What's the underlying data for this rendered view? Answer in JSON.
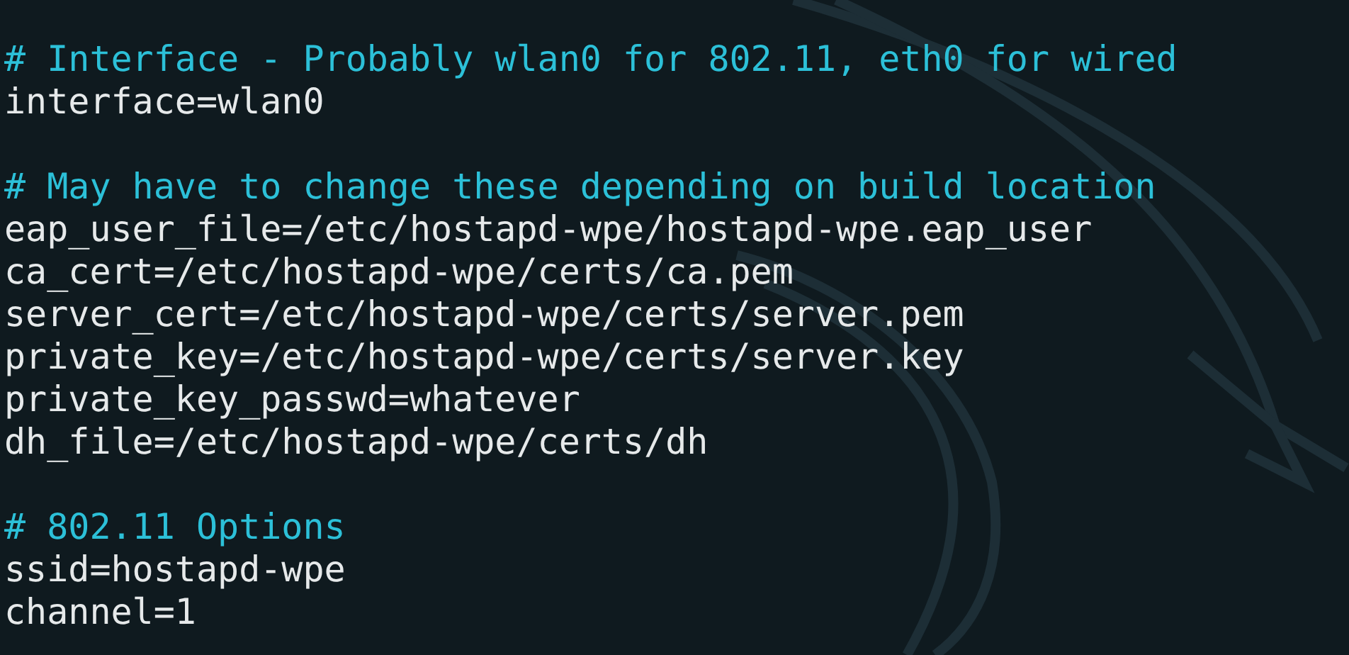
{
  "terminal": {
    "lines": [
      {
        "kind": "comment",
        "text": "# Interface - Probably wlan0 for 802.11, eth0 for wired"
      },
      {
        "kind": "code",
        "text": "interface=wlan0"
      },
      {
        "kind": "blank"
      },
      {
        "kind": "comment",
        "text": "# May have to change these depending on build location"
      },
      {
        "kind": "code",
        "text": "eap_user_file=/etc/hostapd-wpe/hostapd-wpe.eap_user"
      },
      {
        "kind": "code",
        "text": "ca_cert=/etc/hostapd-wpe/certs/ca.pem"
      },
      {
        "kind": "code",
        "text": "server_cert=/etc/hostapd-wpe/certs/server.pem"
      },
      {
        "kind": "code",
        "text": "private_key=/etc/hostapd-wpe/certs/server.key"
      },
      {
        "kind": "code",
        "text": "private_key_passwd=whatever"
      },
      {
        "kind": "code",
        "text": "dh_file=/etc/hostapd-wpe/certs/dh"
      },
      {
        "kind": "blank"
      },
      {
        "kind": "comment",
        "text": "# 802.11 Options"
      },
      {
        "kind": "code",
        "text": "ssid=hostapd-wpe"
      },
      {
        "kind": "code",
        "text": "channel=1"
      }
    ]
  }
}
